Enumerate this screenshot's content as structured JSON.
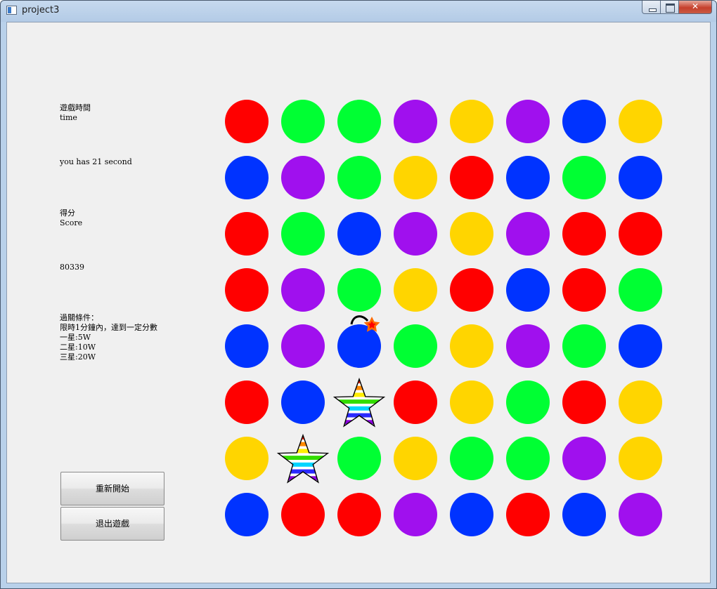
{
  "window": {
    "title": "project3"
  },
  "info": {
    "time_heading": "遊戲時間\ntime",
    "time_remaining": "you has 21 second",
    "score_heading": "得分\nScore",
    "score_value": "80339",
    "goal_text": "過關條件：\n限時1分鐘內，達到一定分數\n一星:5W\n二星:10W\n三星:20W"
  },
  "buttons": {
    "restart": "重新開始",
    "quit": "退出遊戲"
  },
  "board": {
    "rows": 8,
    "cols": 8,
    "cells": [
      [
        "red",
        "green",
        "green",
        "purple",
        "yellow",
        "purple",
        "blue",
        "yellow"
      ],
      [
        "blue",
        "purple",
        "green",
        "yellow",
        "red",
        "blue",
        "green",
        "blue"
      ],
      [
        "red",
        "green",
        "blue",
        "purple",
        "yellow",
        "purple",
        "red",
        "red"
      ],
      [
        "red",
        "purple",
        "green",
        "yellow",
        "red",
        "blue",
        "red",
        "green"
      ],
      [
        "blue",
        "purple",
        "bomb",
        "green",
        "yellow",
        "purple",
        "green",
        "blue"
      ],
      [
        "red",
        "blue",
        "rainbow-star",
        "red",
        "yellow",
        "green",
        "red",
        "yellow"
      ],
      [
        "yellow",
        "rainbow-star",
        "green",
        "yellow",
        "green",
        "green",
        "purple",
        "yellow"
      ],
      [
        "blue",
        "red",
        "red",
        "purple",
        "blue",
        "red",
        "blue",
        "purple"
      ]
    ]
  },
  "colors": {
    "red": "#ff0000",
    "green": "#00ff33",
    "purple": "#a010ee",
    "yellow": "#ffd500",
    "blue": "#0033ff"
  }
}
